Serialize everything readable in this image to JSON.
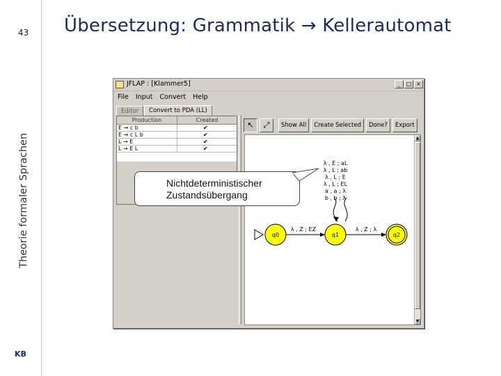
{
  "slide": {
    "page_number": "43",
    "vertical_title": "Theorie formaler Sprachen",
    "title": "Übersetzung: Grammatik → Kellerautomat",
    "logo": "KB"
  },
  "window": {
    "title": "JFLAP : [Klammer5]",
    "controls": [
      "_",
      "□",
      "×"
    ],
    "menu": [
      "File",
      "Input",
      "Convert",
      "Help"
    ],
    "tabs": [
      {
        "label": "Editor",
        "active": false
      },
      {
        "label": "Convert to PDA (LL)",
        "active": true
      }
    ]
  },
  "grammar_table": {
    "headers": [
      "Production",
      "Created"
    ],
    "rows": [
      {
        "production": "E → c b",
        "created": "✔"
      },
      {
        "production": "E → c L b",
        "created": "✔"
      },
      {
        "production": "L → E",
        "created": "✔"
      },
      {
        "production": "L → E L",
        "created": "✔"
      }
    ]
  },
  "toolbar": {
    "icons": [
      "arrow-cursor-icon",
      "state-tool-icon"
    ],
    "buttons": [
      "Show All",
      "Create Selected",
      "Done?",
      "Export"
    ]
  },
  "automaton": {
    "states": [
      "q0",
      "q1",
      "q2"
    ],
    "edge_q0_q1": "λ , Z ; EZ",
    "edge_q1_q2": "λ , Z ; λ",
    "loop_labels": [
      "λ , E ; aL",
      "λ , L ; ab",
      "λ , L ; E",
      "λ , L ; EL",
      "a , a ; λ",
      "b , b ; λ"
    ],
    "state_color": "#ffff00"
  },
  "callout": {
    "text": "Nichtdeterministischer\nZustandsübergang"
  }
}
